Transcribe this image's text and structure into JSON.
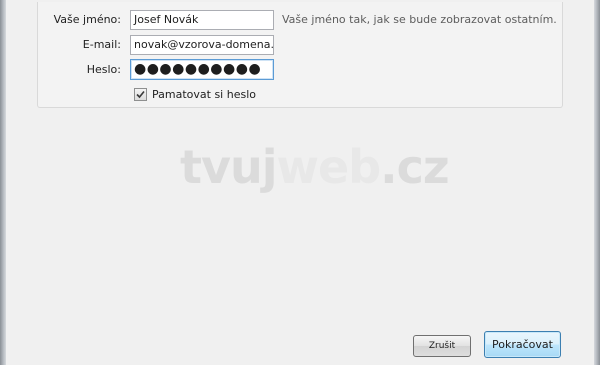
{
  "form": {
    "name_label": "Vaše jméno:",
    "name_value": "Josef Novák",
    "name_hint": "Vaše jméno tak, jak se bude zobrazovat ostatním.",
    "email_label": "E-mail:",
    "email_value": "novak@vzorova-domena.cz",
    "password_label": "Heslo:",
    "password_value": "●●●●●●●●●●",
    "remember_label": "Pamatovat si heslo",
    "remember_checked": true
  },
  "watermark": {
    "part1": "tvuj",
    "part2": "web",
    "part3": ".cz"
  },
  "buttons": {
    "cancel_label": "Zrušit",
    "continue_label": "Pokračovat"
  },
  "colors": {
    "focus_border": "#5b9bd5",
    "default_button": "#3c7fb1",
    "watermark": "#dbdbdb"
  }
}
